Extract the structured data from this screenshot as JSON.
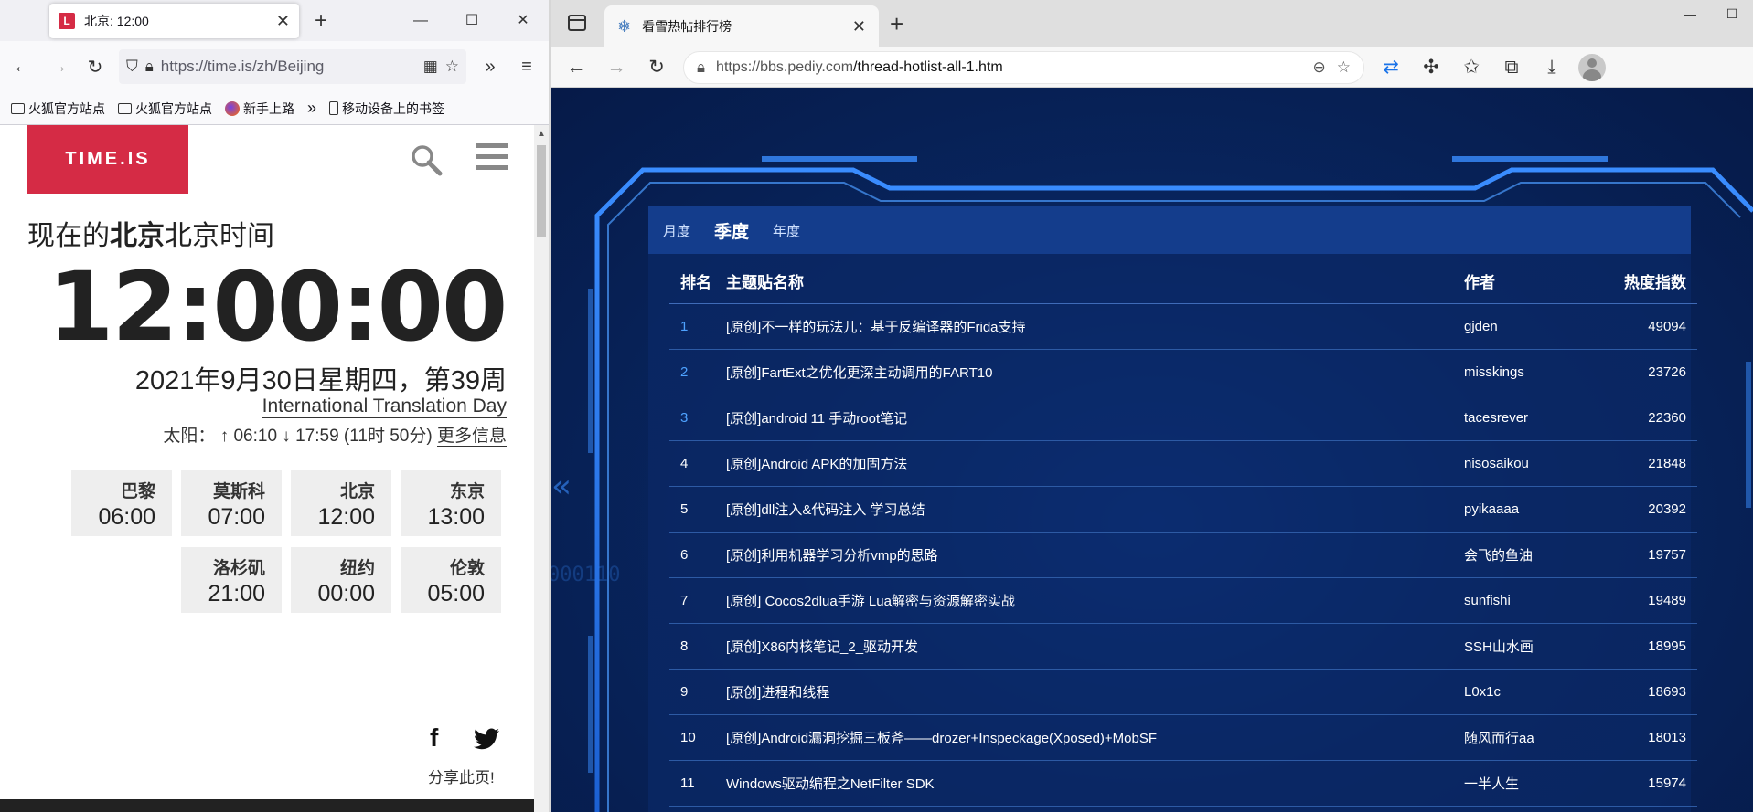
{
  "firefox": {
    "tab_title": "北京: 12:00",
    "tab_favicon": "L",
    "url": "https://time.is/zh/Beijing",
    "bookmarks": [
      "火狐官方站点",
      "火狐官方站点",
      "新手上路"
    ],
    "mobile_bookmarks": "移动设备上的书签",
    "page": {
      "logo": "TIME.IS",
      "heading_prefix": "现在的",
      "heading_city": "北京",
      "heading_suffix": "北京时间",
      "clock": "12:00:00",
      "date": "2021年9月30日星期四，第39周",
      "event": "International Translation Day",
      "sun_label": "太阳：",
      "sun_times": "↑ 06:10 ↓ 17:59 (11时 50分)",
      "sun_more": "更多信息",
      "cities": [
        {
          "name": "巴黎",
          "time": "06:00"
        },
        {
          "name": "莫斯科",
          "time": "07:00"
        },
        {
          "name": "北京",
          "time": "12:00"
        },
        {
          "name": "东京",
          "time": "13:00"
        },
        {
          "name": "洛杉矶",
          "time": "21:00"
        },
        {
          "name": "纽约",
          "time": "00:00"
        },
        {
          "name": "伦敦",
          "time": "05:00"
        }
      ],
      "share": "分享此页!",
      "facebook": "f"
    }
  },
  "edge": {
    "tab_title": "看雪热帖排行榜",
    "url_host": "https://bbs.pediy.com",
    "url_path": "/thread-hotlist-all-1.htm",
    "page": {
      "tabs": [
        "月度",
        "季度",
        "年度"
      ],
      "active_tab": "季度",
      "headers": {
        "rank": "排名",
        "title": "主题贴名称",
        "author": "作者",
        "heat": "热度指数"
      },
      "rows": [
        {
          "rank": "1",
          "title": "[原创]不一样的玩法儿：基于反编译器的Frida支持",
          "author": "gjden",
          "heat": "49094"
        },
        {
          "rank": "2",
          "title": "[原创]FartExt之优化更深主动调用的FART10",
          "author": "misskings",
          "heat": "23726"
        },
        {
          "rank": "3",
          "title": "[原创]android 11 手动root笔记",
          "author": "tacesrever",
          "heat": "22360"
        },
        {
          "rank": "4",
          "title": "[原创]Android APK的加固方法",
          "author": "nisosaikou",
          "heat": "21848"
        },
        {
          "rank": "5",
          "title": "[原创]dll注入&代码注入 学习总结",
          "author": "pyikaaaa",
          "heat": "20392"
        },
        {
          "rank": "6",
          "title": "[原创]利用机器学习分析vmp的思路",
          "author": "会飞的鱼油",
          "heat": "19757"
        },
        {
          "rank": "7",
          "title": "[原创] Cocos2dlua手游 Lua解密与资源解密实战",
          "author": "sunfishi",
          "heat": "19489"
        },
        {
          "rank": "8",
          "title": "[原创]X86内核笔记_2_驱动开发",
          "author": "SSH山水画",
          "heat": "18995"
        },
        {
          "rank": "9",
          "title": "[原创]进程和线程",
          "author": "L0x1c",
          "heat": "18693"
        },
        {
          "rank": "10",
          "title": "[原创]Android漏洞挖掘三板斧——drozer+Inspeckage(Xposed)+MobSF",
          "author": "随风而行aa",
          "heat": "18013"
        },
        {
          "rank": "11",
          "title": "Windows驱动编程之NetFilter SDK",
          "author": "一半人生",
          "heat": "15974"
        }
      ]
    }
  },
  "colors": {
    "timeis_red": "#d52b45",
    "rank_top_blue": "#4ea2ff",
    "hud_blue": "#3a8dff"
  }
}
